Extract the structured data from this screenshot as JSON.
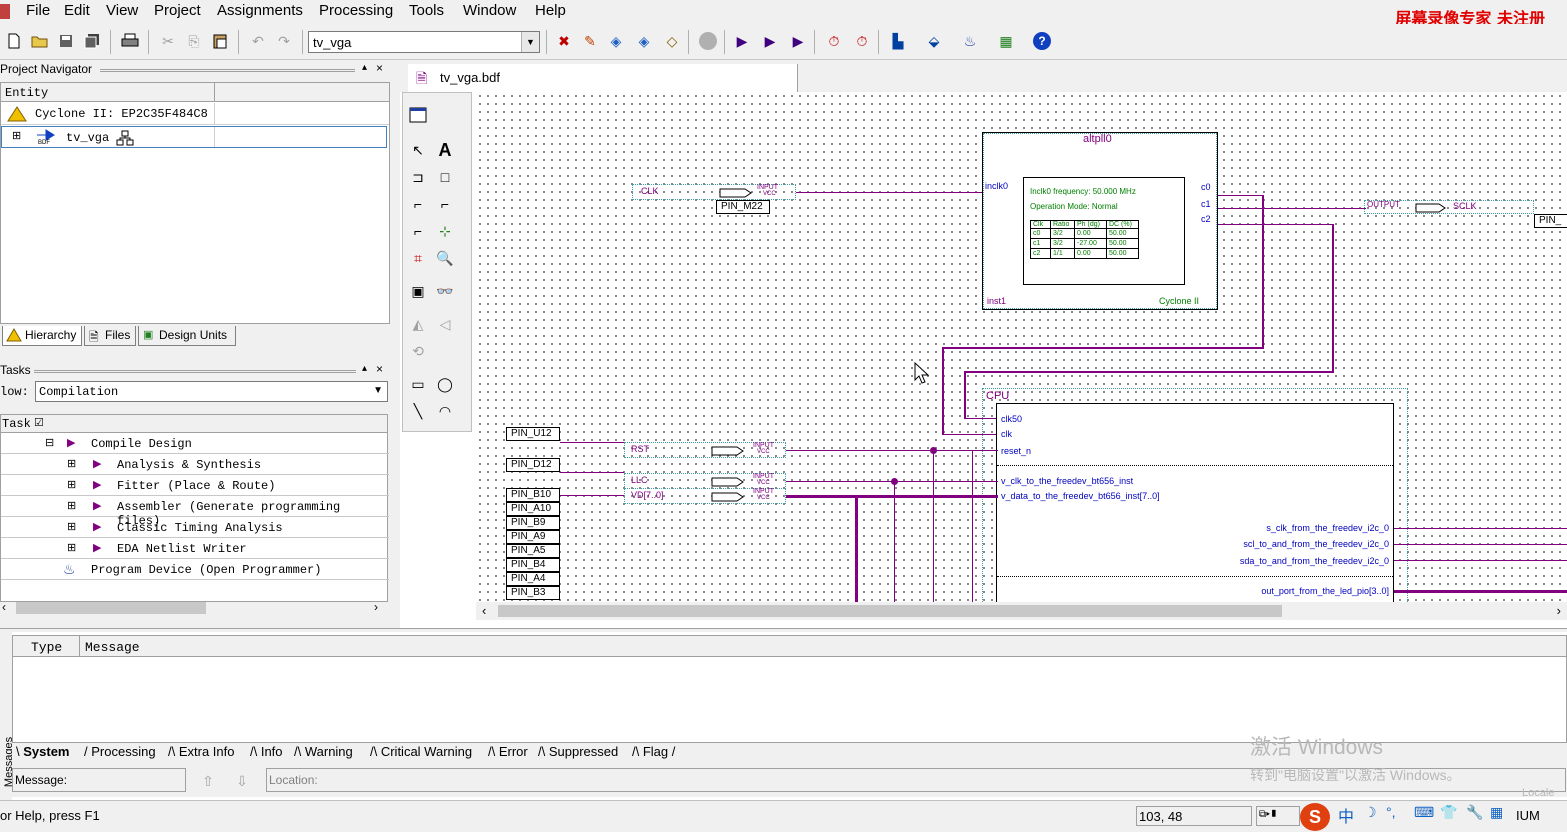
{
  "menu": [
    "File",
    "Edit",
    "View",
    "Project",
    "Assignments",
    "Processing",
    "Tools",
    "Window",
    "Help"
  ],
  "watermark_top": "屏幕录像专家 未注册",
  "toolbar": {
    "project_combo": "tv_vga"
  },
  "navigator": {
    "title": "Project Navigator",
    "col_entity": "Entity",
    "device": "Cyclone II: EP2C35F484C8",
    "top_entity": "tv_vga",
    "bdf_tag": "BDF",
    "tabs": [
      "Hierarchy",
      "Files",
      "Design Units"
    ]
  },
  "tasks": {
    "title": "Tasks",
    "flow_label": "low:",
    "flow_value": "Compilation",
    "col_task": "Task",
    "items": [
      "Compile Design",
      "Analysis & Synthesis",
      "Fitter (Place & Route)",
      "Assembler (Generate programming files)",
      "Classic Timing Analysis",
      "EDA Netlist Writer",
      "Program Device (Open Programmer)"
    ]
  },
  "editor": {
    "tab_title": "tv_vga.bdf",
    "pll": {
      "title": "altpll0",
      "in_port": "inclk0",
      "out_ports": [
        "c0",
        "c1",
        "c2"
      ],
      "line1": "Inclk0 frequency: 50.000 MHz",
      "line2": "Operation Mode: Normal",
      "table_head": [
        "Clk",
        "Ratio",
        "Ph (dg)",
        "DC (%)"
      ],
      "table_rows": [
        [
          "c0",
          "3/2",
          "0.00",
          "50.00"
        ],
        [
          "c1",
          "3/2",
          "-27.00",
          "50.00"
        ],
        [
          "c2",
          "1/1",
          "0.00",
          "50.00"
        ]
      ],
      "inst": "inst1",
      "family": "Cyclone II"
    },
    "clk_input": {
      "name": "CLK",
      "type": "INPUT",
      "vcc": "VCC",
      "pin": "PIN_M22"
    },
    "output": {
      "type": "OUTPUT",
      "name": "SCLK",
      "pin": "PIN_"
    },
    "cpu": {
      "title": "CPU",
      "in_ports": [
        "clk50",
        "clk",
        "reset_n",
        "v_clk_to_the_freedev_bt656_inst",
        "v_data_to_the_freedev_bt656_inst[7..0]"
      ],
      "out_ports": [
        "s_clk_from_the_freedev_i2c_0",
        "scl_to_and_from_the_freedev_i2c_0",
        "sda_to_and_from_the_freedev_i2c_0",
        "out_port_from_the_led_pio[3..0]"
      ]
    },
    "inputs": [
      {
        "pin": "PIN_U12",
        "name": "RST",
        "type": "INPUT",
        "vcc": "VCC"
      },
      {
        "pin": "PIN_D12",
        "name": "LLC",
        "type": "INPUT",
        "vcc": "VCC"
      },
      {
        "pin": "PIN_B10",
        "name": "VD[7..0]",
        "type": "INPUT",
        "vcc": "VCC"
      }
    ],
    "bus_pins": [
      "PIN_B10",
      "PIN_A10",
      "PIN_B9",
      "PIN_A9",
      "PIN_A5",
      "PIN_B4",
      "PIN_A4",
      "PIN_B3"
    ]
  },
  "messages": {
    "col_type": "Type",
    "col_message": "Message",
    "side_label": "Messages",
    "tabs": [
      "System",
      "Processing",
      "Extra Info",
      "Info",
      "Warning",
      "Critical Warning",
      "Error",
      "Suppressed",
      "Flag"
    ],
    "message_label": "Message:",
    "location_label": "Location:",
    "activate_1": "激活 Windows",
    "activate_2": "转到\"电脑设置\"以激活 Windows。"
  },
  "status": {
    "help": "or Help, press F1",
    "coords": "103, 48",
    "ime_zh": "中",
    "locale": "Locale",
    "num": "IUM"
  },
  "colors": {
    "accent_purple": "#800080",
    "port_blue": "#0000c0",
    "watermark_red": "#e00000"
  }
}
